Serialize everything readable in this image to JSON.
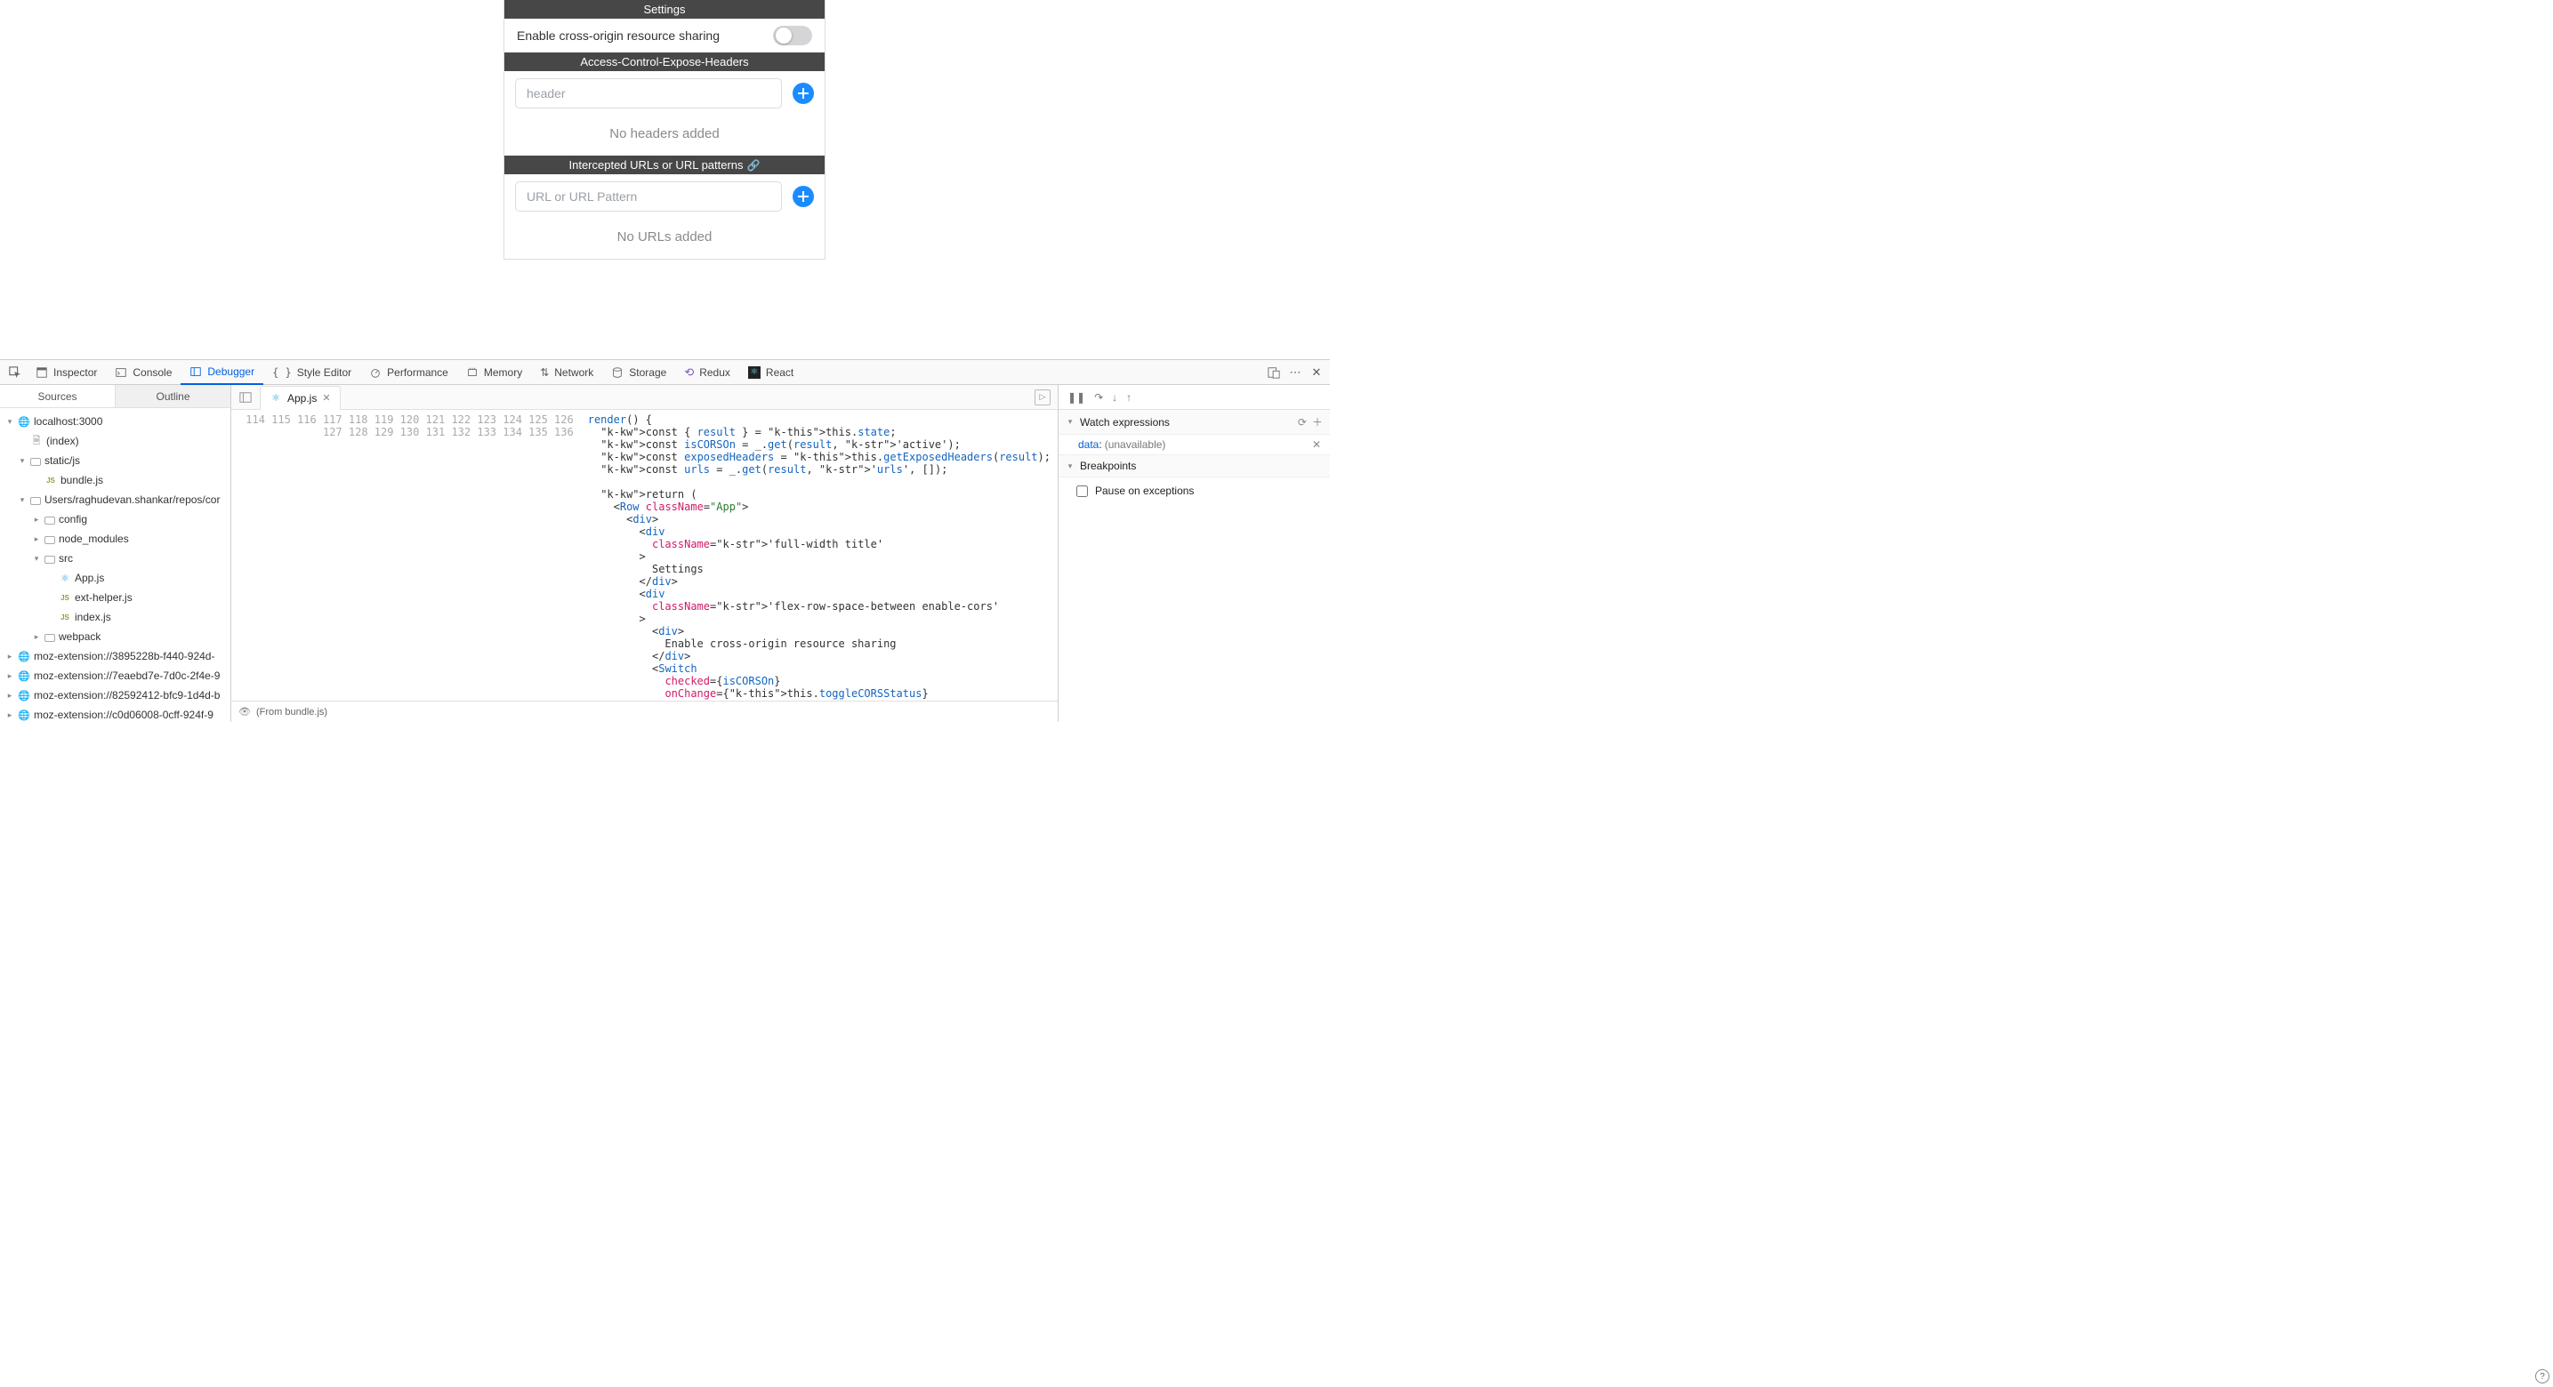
{
  "settings": {
    "title": "Settings",
    "cors_label": "Enable cross-origin resource sharing",
    "cors_enabled": false,
    "expose_headers_title": "Access-Control-Expose-Headers",
    "header_placeholder": "header",
    "no_headers": "No headers added",
    "urls_title": "Intercepted URLs or URL patterns",
    "url_placeholder": "URL or URL Pattern",
    "no_urls": "No URLs added"
  },
  "devtools": {
    "tabs": [
      "Inspector",
      "Console",
      "Debugger",
      "Style Editor",
      "Performance",
      "Memory",
      "Network",
      "Storage",
      "Redux",
      "React"
    ],
    "active_tab": "Debugger",
    "left_tabs": {
      "sources": "Sources",
      "outline": "Outline"
    },
    "tree": [
      {
        "depth": 0,
        "twisty": "▾",
        "icon": "globe",
        "label": "localhost:3000"
      },
      {
        "depth": 1,
        "twisty": "",
        "icon": "file",
        "label": "(index)"
      },
      {
        "depth": 1,
        "twisty": "▾",
        "icon": "folder",
        "label": "static/js"
      },
      {
        "depth": 2,
        "twisty": "",
        "icon": "js",
        "label": "bundle.js"
      },
      {
        "depth": 1,
        "twisty": "▾",
        "icon": "folder",
        "label": "Users/raghudevan.shankar/repos/cor"
      },
      {
        "depth": 2,
        "twisty": "▸",
        "icon": "folder",
        "label": "config"
      },
      {
        "depth": 2,
        "twisty": "▸",
        "icon": "folder",
        "label": "node_modules"
      },
      {
        "depth": 2,
        "twisty": "▾",
        "icon": "folder",
        "label": "src"
      },
      {
        "depth": 3,
        "twisty": "",
        "icon": "react",
        "label": "App.js"
      },
      {
        "depth": 3,
        "twisty": "",
        "icon": "js",
        "label": "ext-helper.js"
      },
      {
        "depth": 3,
        "twisty": "",
        "icon": "js",
        "label": "index.js"
      },
      {
        "depth": 2,
        "twisty": "▸",
        "icon": "folder",
        "label": "webpack"
      },
      {
        "depth": 0,
        "twisty": "▸",
        "icon": "globe",
        "label": "moz-extension://3895228b-f440-924d-"
      },
      {
        "depth": 0,
        "twisty": "▸",
        "icon": "globe",
        "label": "moz-extension://7eaebd7e-7d0c-2f4e-9"
      },
      {
        "depth": 0,
        "twisty": "▸",
        "icon": "globe",
        "label": "moz-extension://82592412-bfc9-1d4d-b"
      },
      {
        "depth": 0,
        "twisty": "▸",
        "icon": "globe",
        "label": "moz-extension://c0d06008-0cff-924f-9"
      }
    ],
    "open_file": "App.js",
    "code_start_line": 114,
    "code_lines": [
      "render() {",
      "  const { result } = this.state;",
      "  const isCORSOn = _.get(result, 'active');",
      "  const exposedHeaders = this.getExposedHeaders(result);",
      "  const urls = _.get(result, 'urls', []);",
      "",
      "  return (",
      "    <Row className=\"App\">",
      "      <div>",
      "        <div",
      "          className='full-width title'",
      "        >",
      "          Settings",
      "        </div>",
      "        <div",
      "          className='flex-row-space-between enable-cors'",
      "        >",
      "          <div>",
      "            Enable cross-origin resource sharing",
      "          </div>",
      "          <Switch",
      "            checked={isCORSOn}",
      "            onChange={this.toggleCORSStatus}"
    ],
    "footer_text": "(From bundle.js)",
    "watch_title": "Watch expressions",
    "watch_items": [
      {
        "name": "data",
        "value": "(unavailable)"
      }
    ],
    "breakpoints_title": "Breakpoints",
    "pause_on_exceptions": "Pause on exceptions"
  }
}
